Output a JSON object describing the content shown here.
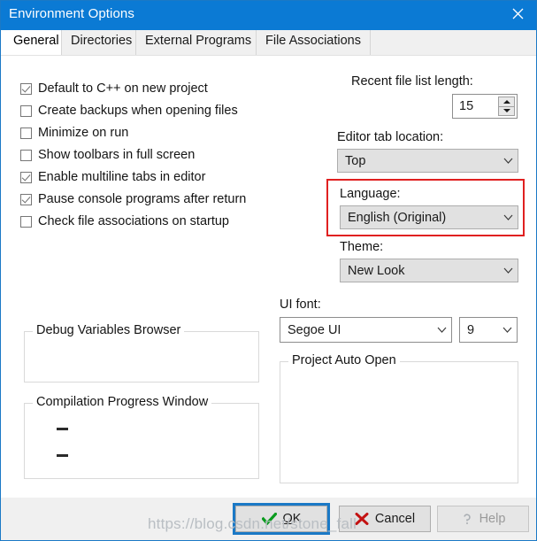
{
  "window": {
    "title": "Environment Options",
    "close_icon": "close-icon",
    "titlebar_color": "#0b7ad4"
  },
  "tabs": [
    {
      "label": "General",
      "active": true
    },
    {
      "label": "Directories",
      "active": false
    },
    {
      "label": "External Programs",
      "active": false
    },
    {
      "label": "File Associations",
      "active": false
    }
  ],
  "checkboxes": [
    {
      "label": "Default to C++ on new project",
      "checked": true
    },
    {
      "label": "Create backups when opening files",
      "checked": false
    },
    {
      "label": "Minimize on run",
      "checked": false
    },
    {
      "label": "Show toolbars in full screen",
      "checked": false
    },
    {
      "label": "Enable multiline tabs in editor",
      "checked": true
    },
    {
      "label": "Pause console programs after return",
      "checked": true
    },
    {
      "label": "Check file associations on startup",
      "checked": false
    }
  ],
  "recent_files": {
    "label": "Recent file list length:",
    "value": "15",
    "up_icon": "spinner-up-icon",
    "down_icon": "spinner-down-icon"
  },
  "editor_tab_location": {
    "label": "Editor tab location:",
    "value": "Top",
    "chevron_icon": "chevron-down-icon"
  },
  "language": {
    "label": "Language:",
    "value": "English (Original)",
    "chevron_icon": "chevron-down-icon",
    "highlight_color": "#e02020"
  },
  "theme": {
    "label": "Theme:",
    "value": "New Look",
    "chevron_icon": "chevron-down-icon"
  },
  "ui_font": {
    "label": "UI font:",
    "family_value": "Segoe UI",
    "size_value": "9",
    "chevron_icon": "chevron-down-icon"
  },
  "groups": {
    "debug_variables_browser": {
      "title": "Debug Variables Browser"
    },
    "compilation_progress_window": {
      "title": "Compilation Progress Window"
    },
    "project_auto_open": {
      "title": "Project Auto Open"
    }
  },
  "buttons": {
    "ok": {
      "accel": "O",
      "rest": "K",
      "icon": "green-check-icon"
    },
    "cancel": {
      "label": "Cancel",
      "icon": "red-x-icon"
    },
    "help": {
      "label": "Help",
      "icon": "question-mark-icon",
      "disabled": true
    }
  },
  "watermark": {
    "text": "https://blog.csdn.net/stone_fall"
  }
}
